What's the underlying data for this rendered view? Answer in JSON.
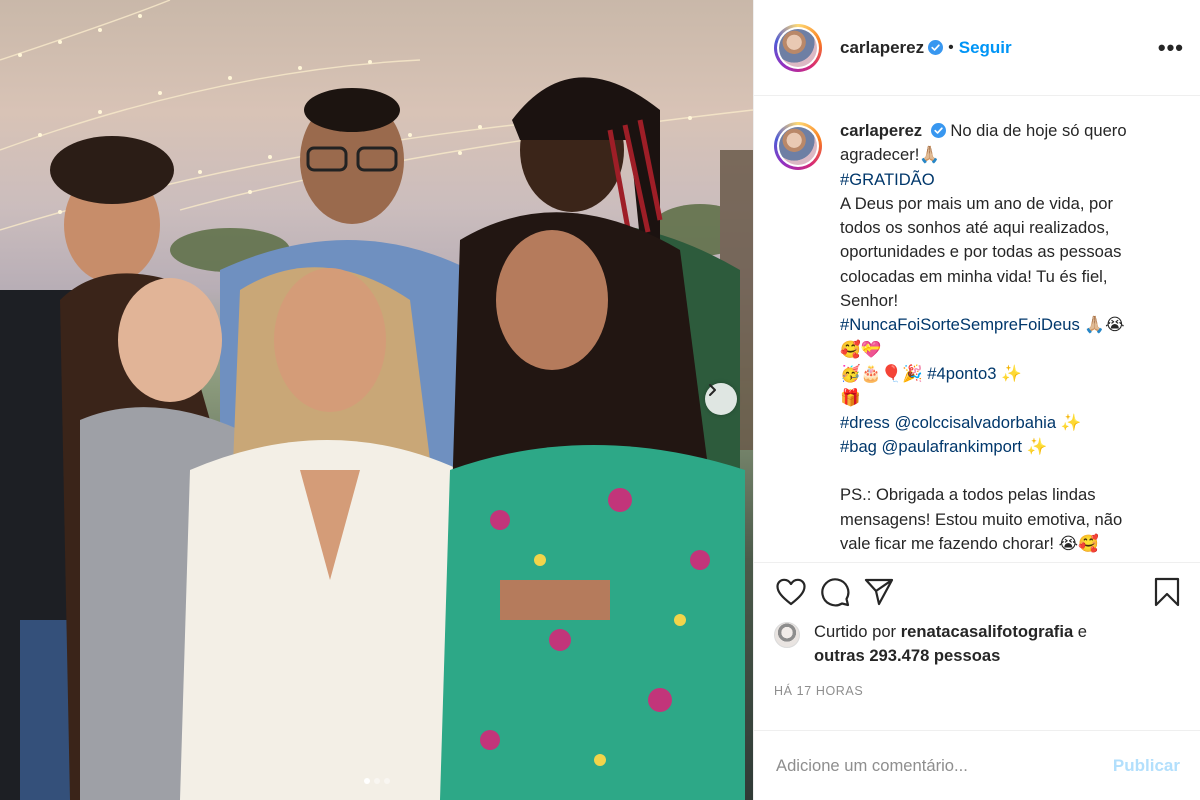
{
  "post": {
    "username": "carlaperez",
    "separator": "•",
    "follow_label": "Seguir",
    "more_label": "•••",
    "caption_lines": [
      {
        "type": "text",
        "value": "No dia de hoje só quero"
      },
      {
        "type": "text",
        "value": "agradecer!🙏🏼"
      },
      {
        "type": "hash",
        "value": "#GRATIDÃO"
      },
      {
        "type": "text",
        "value": "A Deus por mais um ano de vida, por"
      },
      {
        "type": "text",
        "value": "todos os sonhos até aqui realizados,"
      },
      {
        "type": "text",
        "value": "oportunidades e por todas as pessoas"
      },
      {
        "type": "text",
        "value": "colocadas em minha vida! Tu és fiel,"
      },
      {
        "type": "text",
        "value": "Senhor!"
      },
      {
        "type": "hash",
        "value": "#NuncaFoiSorteSempreFoiDeus",
        "suffix": " 🙏🏼😭"
      },
      {
        "type": "text",
        "value": "🥰💝"
      },
      {
        "type": "emoji-hash",
        "prefix": "🥳🎂🎈🎉 ",
        "value": "#4ponto3",
        "suffix": " ✨"
      },
      {
        "type": "text",
        "value": "🎁"
      },
      {
        "type": "hash",
        "value": "#dress",
        "mention": "@colccisalvadorbahia",
        "suffix": " ✨"
      },
      {
        "type": "hash",
        "value": "#bag",
        "mention": "@paulafrankimport",
        "suffix": " ✨"
      },
      {
        "type": "blank",
        "value": ""
      },
      {
        "type": "text",
        "value": "PS.: Obrigada a todos pelas lindas"
      },
      {
        "type": "text",
        "value": "mensagens! Estou muito emotiva, não"
      },
      {
        "type": "text",
        "value": "vale ficar me fazendo chorar! 😭🥰"
      }
    ],
    "likes": {
      "prefix": "Curtido por",
      "liker": "renatacasalifotografia",
      "joiner": "e",
      "others": "outras 293.478 pessoas"
    },
    "timestamp": "HÁ 17 HORAS",
    "comment_placeholder": "Adicione um comentário...",
    "publish_label": "Publicar",
    "carousel": {
      "count": 3,
      "active": 0
    },
    "icons": {
      "verified": "verified-badge-icon",
      "like": "heart-icon",
      "comment": "comment-bubble-icon",
      "share": "paper-plane-icon",
      "save": "bookmark-icon",
      "next": "chevron-right-icon"
    },
    "colors": {
      "accent": "#0095f6",
      "link": "#00376b",
      "muted": "#8e8e8e",
      "publish_disabled": "#b2dffc",
      "text": "#262626"
    }
  }
}
